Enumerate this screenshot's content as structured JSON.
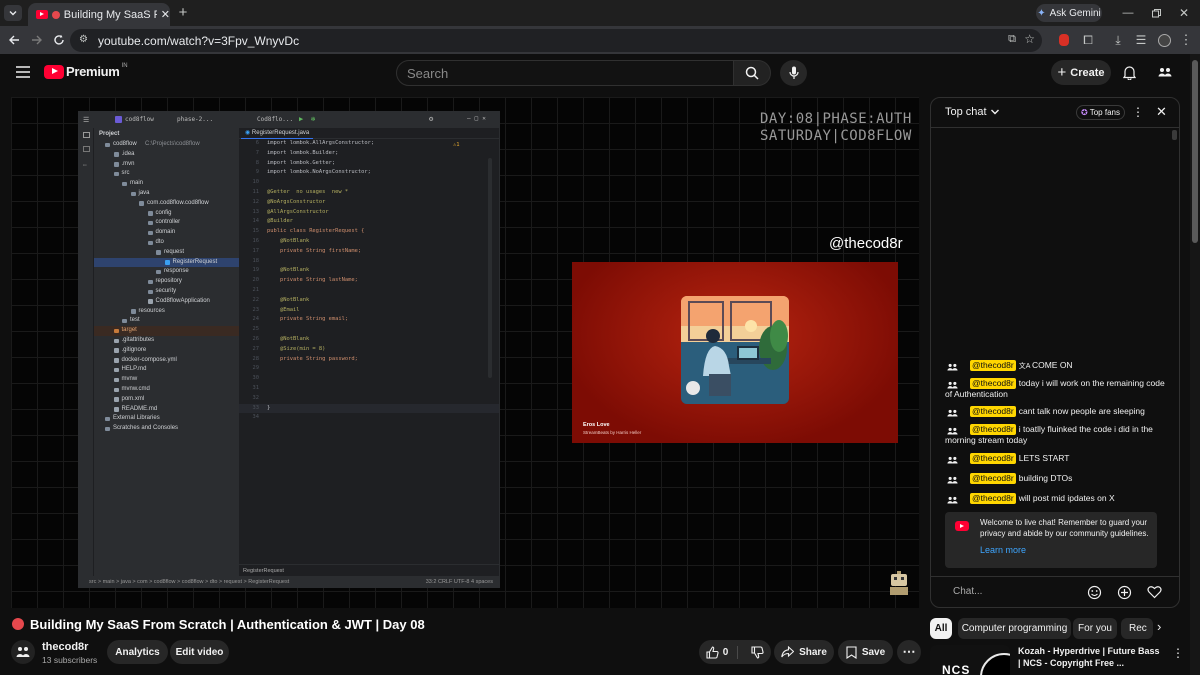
{
  "browser": {
    "tab_title": "Building My SaaS From Scra",
    "url": "youtube.com/watch?v=3Fpv_WnyvDc",
    "ask_gemini": "Ask Gemini"
  },
  "header": {
    "logo_text": "Premium",
    "region": "IN",
    "search_placeholder": "Search",
    "create_label": "Create"
  },
  "video": {
    "overlay_line1": "DAY:08|PHASE:AUTH",
    "overlay_line2": "SATURDAY|COD8FLOW",
    "handle": "@thecod8r",
    "music_title": "Eros Love",
    "music_subtitle": "StreamBeats by Harris Heller",
    "ide": {
      "project_name": "cod8flow",
      "branch": "phase-2...",
      "tab_file": "RegisterRequest.java",
      "project_label": "Project",
      "tree": [
        {
          "label": "cod8flow",
          "suffix": "C:\\Projects\\cod8flow",
          "depth": 0
        },
        {
          "label": ".idea",
          "depth": 1
        },
        {
          "label": ".mvn",
          "depth": 1
        },
        {
          "label": "src",
          "depth": 1
        },
        {
          "label": "main",
          "depth": 2
        },
        {
          "label": "java",
          "depth": 3
        },
        {
          "label": "com.cod8flow.cod8flow",
          "depth": 4
        },
        {
          "label": "config",
          "depth": 5
        },
        {
          "label": "controller",
          "depth": 5
        },
        {
          "label": "domain",
          "depth": 5
        },
        {
          "label": "dto",
          "depth": 5
        },
        {
          "label": "request",
          "depth": 6
        },
        {
          "label": "RegisterRequest",
          "depth": 7,
          "selected": true
        },
        {
          "label": "response",
          "depth": 6
        },
        {
          "label": "repository",
          "depth": 5
        },
        {
          "label": "security",
          "depth": 5
        },
        {
          "label": "Cod8flowApplication",
          "depth": 5
        },
        {
          "label": "resources",
          "depth": 3
        },
        {
          "label": "test",
          "depth": 2
        },
        {
          "label": "target",
          "depth": 1,
          "target": true
        },
        {
          "label": ".gitattributes",
          "depth": 1
        },
        {
          "label": ".gitignore",
          "depth": 1
        },
        {
          "label": "docker-compose.yml",
          "depth": 1
        },
        {
          "label": "HELP.md",
          "depth": 1
        },
        {
          "label": "mvnw",
          "depth": 1
        },
        {
          "label": "mvnw.cmd",
          "depth": 1
        },
        {
          "label": "pom.xml",
          "depth": 1
        },
        {
          "label": "README.md",
          "depth": 1
        },
        {
          "label": "External Libraries",
          "depth": 0
        },
        {
          "label": "Scratches and Consoles",
          "depth": 0
        }
      ],
      "code": [
        {
          "n": "6",
          "t": "import lombok.AllArgsConstructor;",
          "c": "imp"
        },
        {
          "n": "7",
          "t": "import lombok.Builder;",
          "c": "imp"
        },
        {
          "n": "8",
          "t": "import lombok.Getter;",
          "c": "imp"
        },
        {
          "n": "9",
          "t": "import lombok.NoArgsConstructor;",
          "c": "imp"
        },
        {
          "n": "10",
          "t": "",
          "c": ""
        },
        {
          "n": "11",
          "t": "@Getter  no usages  new *",
          "c": "ann"
        },
        {
          "n": "12",
          "t": "@NoArgsConstructor",
          "c": "ann"
        },
        {
          "n": "13",
          "t": "@AllArgsConstructor",
          "c": "ann"
        },
        {
          "n": "14",
          "t": "@Builder",
          "c": "ann"
        },
        {
          "n": "15",
          "t": "public class RegisterRequest {",
          "c": "kw"
        },
        {
          "n": "16",
          "t": "    @NotBlank",
          "c": "ann"
        },
        {
          "n": "17",
          "t": "    private String firstName;",
          "c": "kw"
        },
        {
          "n": "18",
          "t": "",
          "c": ""
        },
        {
          "n": "19",
          "t": "    @NotBlank",
          "c": "ann"
        },
        {
          "n": "20",
          "t": "    private String lastName;",
          "c": "kw"
        },
        {
          "n": "21",
          "t": "",
          "c": ""
        },
        {
          "n": "22",
          "t": "    @NotBlank",
          "c": "ann"
        },
        {
          "n": "23",
          "t": "    @Email",
          "c": "ann"
        },
        {
          "n": "24",
          "t": "    private String email;",
          "c": "kw"
        },
        {
          "n": "25",
          "t": "",
          "c": ""
        },
        {
          "n": "26",
          "t": "    @NotBlank",
          "c": "ann"
        },
        {
          "n": "27",
          "t": "    @Size(min = 8)",
          "c": "ann"
        },
        {
          "n": "28",
          "t": "    private String password;",
          "c": "kw"
        },
        {
          "n": "29",
          "t": "",
          "c": ""
        },
        {
          "n": "30",
          "t": "",
          "c": ""
        },
        {
          "n": "31",
          "t": "",
          "c": ""
        },
        {
          "n": "32",
          "t": "",
          "c": ""
        },
        {
          "n": "33",
          "t": "}",
          "c": "plain"
        },
        {
          "n": "34",
          "t": "",
          "c": ""
        }
      ],
      "editor_footer": "RegisterRequest",
      "breadcrumb": "src  >  main  >  java  >  com  >  cod8flow  >  cod8flow  >  dto  >  request  >  RegisterRequest",
      "status_right": "33:2   CRLF   UTF-8   4 spaces"
    }
  },
  "info": {
    "title": "Building My SaaS From Scratch | Authentication & JWT | Day 08",
    "channel": "thecod8r",
    "subscribers": "13 subscribers",
    "analytics": "Analytics",
    "edit_video": "Edit video",
    "likes": "0",
    "share": "Share",
    "save": "Save"
  },
  "chat": {
    "header": "Top chat",
    "top_fans": "Top fans",
    "messages": [
      {
        "user": "@thecod8r",
        "text": "COME ON"
      },
      {
        "user": "@thecod8r",
        "text": "today i will work on the remaining code of Authentication"
      },
      {
        "user": "@thecod8r",
        "text": "cant talk now people are sleeping"
      },
      {
        "user": "@thecod8r",
        "text": "i toatlly fluinked the code i did in the morning stream today"
      },
      {
        "user": "@thecod8r",
        "text": "LETS START"
      },
      {
        "user": "@thecod8r",
        "text": "building DTOs"
      },
      {
        "user": "@thecod8r",
        "text": "will post mid ipdates on X"
      }
    ],
    "welcome": "Welcome to live chat! Remember to guard your privacy and abide by our community guidelines.",
    "learn_more": "Learn more",
    "input_placeholder": "Chat..."
  },
  "chips": [
    "All",
    "Computer programming",
    "For you",
    "Rec"
  ],
  "recommended": {
    "title": "Kozah - Hyperdrive | Future Bass | NCS - Copyright Free ...",
    "thumb_text": "NCS"
  },
  "colors": {
    "accent_red": "#ff0033",
    "username_bg": "#ffd600",
    "link_blue": "#3ea6ff"
  }
}
